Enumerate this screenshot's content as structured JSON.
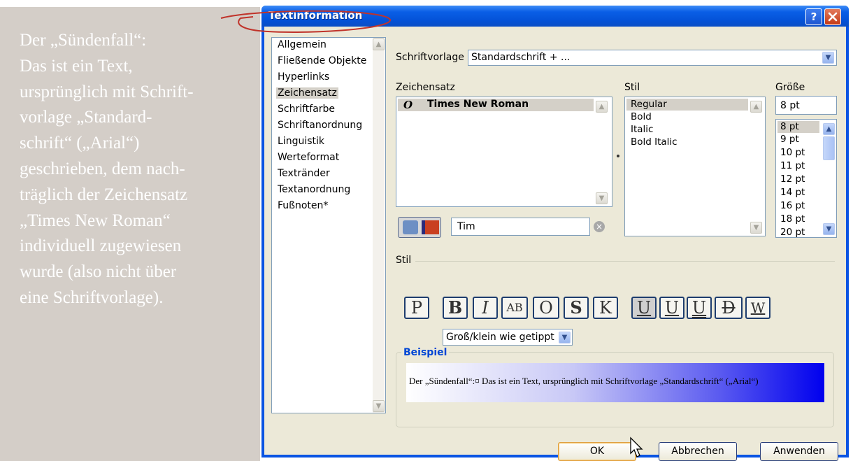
{
  "annotation": {
    "lines": [
      "Der „Sündenfall“:",
      "Das ist ein Text,",
      "ursprünglich mit Schrift-",
      "vorlage „Standard-",
      "schrift“ („Arial“)",
      "geschrieben, dem nach-",
      "träglich der Zeichensatz",
      "„Times New Roman“",
      "individuell zugewiesen",
      "wurde (also nicht über",
      "eine Schriftvorlage)."
    ]
  },
  "window": {
    "title": "Textinformation",
    "help_label": "?"
  },
  "categories": [
    {
      "label": "Allgemein"
    },
    {
      "label": "Fließende Objekte"
    },
    {
      "label": "Hyperlinks"
    },
    {
      "label": "Zeichensatz",
      "selected": true
    },
    {
      "label": "Schriftfarbe"
    },
    {
      "label": "Schriftanordnung"
    },
    {
      "label": "Linguistik"
    },
    {
      "label": "Werteformat"
    },
    {
      "label": "Textränder"
    },
    {
      "label": "Textanordnung"
    },
    {
      "label": "Fußnoten*"
    }
  ],
  "template": {
    "label": "Schriftvorlage",
    "value": "Standardschrift + ..."
  },
  "font": {
    "label": "Zeichensatz",
    "items": [
      "Times New Roman"
    ],
    "search_value": "Tim"
  },
  "style": {
    "label": "Stil",
    "items": [
      "Regular",
      "Bold",
      "Italic",
      "Bold Italic"
    ],
    "selected": "Regular"
  },
  "size": {
    "label": "Größe",
    "value": "8 pt",
    "items": [
      "8 pt",
      "9 pt",
      "10 pt",
      "11 pt",
      "12 pt",
      "14 pt",
      "16 pt",
      "18 pt",
      "20 pt"
    ],
    "selected": "8 pt"
  },
  "stil_section": {
    "label": "Stil",
    "buttons": [
      "P",
      "B",
      "I",
      "AB",
      "O",
      "S",
      "K",
      "U",
      "U",
      "U",
      "D",
      "W"
    ],
    "case_dropdown": "Groß/klein wie getippt"
  },
  "example": {
    "label": "Beispiel",
    "text": "Der „Sündenfall“:¤ Das ist ein Text, ursprünglich mit Schriftvorlage „Standardschrift“ („Arial“)"
  },
  "buttons": {
    "ok": "OK",
    "cancel": "Abbrechen",
    "apply": "Anwenden"
  },
  "colors": {
    "title_bar": "#0a54e3",
    "annotation_ellipse": "#c0332a",
    "example_gradient_end": "#0000ee"
  }
}
